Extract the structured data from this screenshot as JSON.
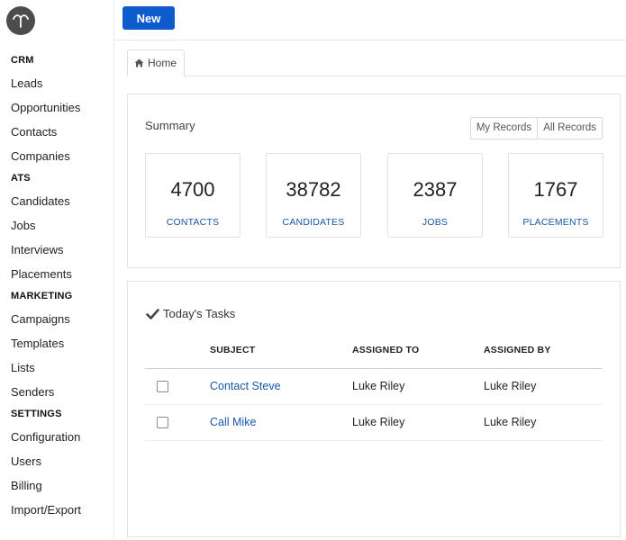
{
  "sidebar": {
    "sections": [
      {
        "title": "CRM",
        "items": [
          "Leads",
          "Opportunities",
          "Contacts",
          "Companies"
        ]
      },
      {
        "title": "ATS",
        "items": [
          "Candidates",
          "Jobs",
          "Interviews",
          "Placements"
        ]
      },
      {
        "title": "MARKETING",
        "items": [
          "Campaigns",
          "Templates",
          "Lists",
          "Senders"
        ]
      },
      {
        "title": "SETTINGS",
        "items": [
          "Configuration",
          "Users",
          "Billing",
          "Import/Export"
        ]
      }
    ]
  },
  "toolbar": {
    "new_label": "New"
  },
  "tabs": [
    {
      "label": "Home",
      "icon": "home-icon"
    }
  ],
  "summary": {
    "title": "Summary",
    "toggle": [
      "My Records",
      "All Records"
    ],
    "stats": [
      {
        "value": "4700",
        "label": "CONTACTS"
      },
      {
        "value": "38782",
        "label": "CANDIDATES"
      },
      {
        "value": "2387",
        "label": "JOBS"
      },
      {
        "value": "1767",
        "label": "PLACEMENTS"
      }
    ]
  },
  "tasks": {
    "title": "Today's Tasks",
    "columns": [
      "SUBJECT",
      "ASSIGNED TO",
      "ASSIGNED BY"
    ],
    "rows": [
      {
        "subject": "Contact Steve",
        "assigned_to": "Luke Riley",
        "assigned_by": "Luke Riley"
      },
      {
        "subject": "Call Mike",
        "assigned_to": "Luke Riley",
        "assigned_by": "Luke Riley"
      }
    ]
  },
  "colors": {
    "primary": "#0d5bcc",
    "link": "#1a56a8",
    "logo_bg": "#4d4d4d"
  }
}
